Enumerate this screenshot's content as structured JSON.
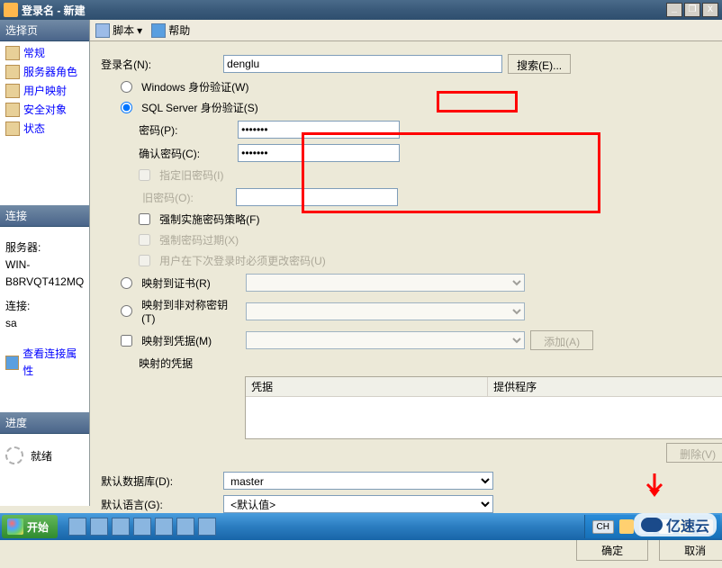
{
  "window": {
    "title": "登录名 - 新建",
    "buttons": {
      "min": "_",
      "max": "❐",
      "close": "X"
    }
  },
  "left": {
    "select_header": "选择页",
    "nav": [
      {
        "icon": "page-icon",
        "label": "常规"
      },
      {
        "icon": "role-icon",
        "label": "服务器角色"
      },
      {
        "icon": "map-icon",
        "label": "用户映射"
      },
      {
        "icon": "secure-icon",
        "label": "安全对象"
      },
      {
        "icon": "status-icon",
        "label": "状态"
      }
    ],
    "conn_header": "连接",
    "server_label": "服务器:",
    "server_value": "WIN-B8RVQT412MQ",
    "conn_label": "连接:",
    "conn_value": "sa",
    "view_props": "查看连接属性",
    "progress_header": "进度",
    "ready": "就绪"
  },
  "toolbar": {
    "script": "脚本",
    "help": "帮助"
  },
  "form": {
    "login_label": "登录名(N):",
    "login_value": "denglu",
    "search_btn": "搜索(E)...",
    "windows_auth": "Windows 身份验证(W)",
    "sql_auth": "SQL Server 身份验证(S)",
    "password_label": "密码(P):",
    "password_value": "●●●●●●●",
    "confirm_label": "确认密码(C):",
    "confirm_value": "●●●●●●●",
    "specify_old": "指定旧密码(I)",
    "old_password": "旧密码(O):",
    "enforce_policy": "强制实施密码策略(F)",
    "enforce_expire": "强制密码过期(X)",
    "must_change": "用户在下次登录时必须更改密码(U)",
    "map_cert": "映射到证书(R)",
    "map_asym": "映射到非对称密钥(T)",
    "map_cred": "映射到凭据(M)",
    "mapped_creds": "映射的凭据",
    "cred_col1": "凭据",
    "cred_col2": "提供程序",
    "add_btn": "添加(A)",
    "delete_btn": "删除(V)",
    "default_db": "默认数据库(D):",
    "default_db_value": "master",
    "default_lang": "默认语言(G):",
    "default_lang_value": "<默认值>"
  },
  "dialog": {
    "ok": "确定",
    "cancel": "取消"
  },
  "taskbar": {
    "start": "开始",
    "lang": "CH"
  },
  "watermark": "亿速云"
}
